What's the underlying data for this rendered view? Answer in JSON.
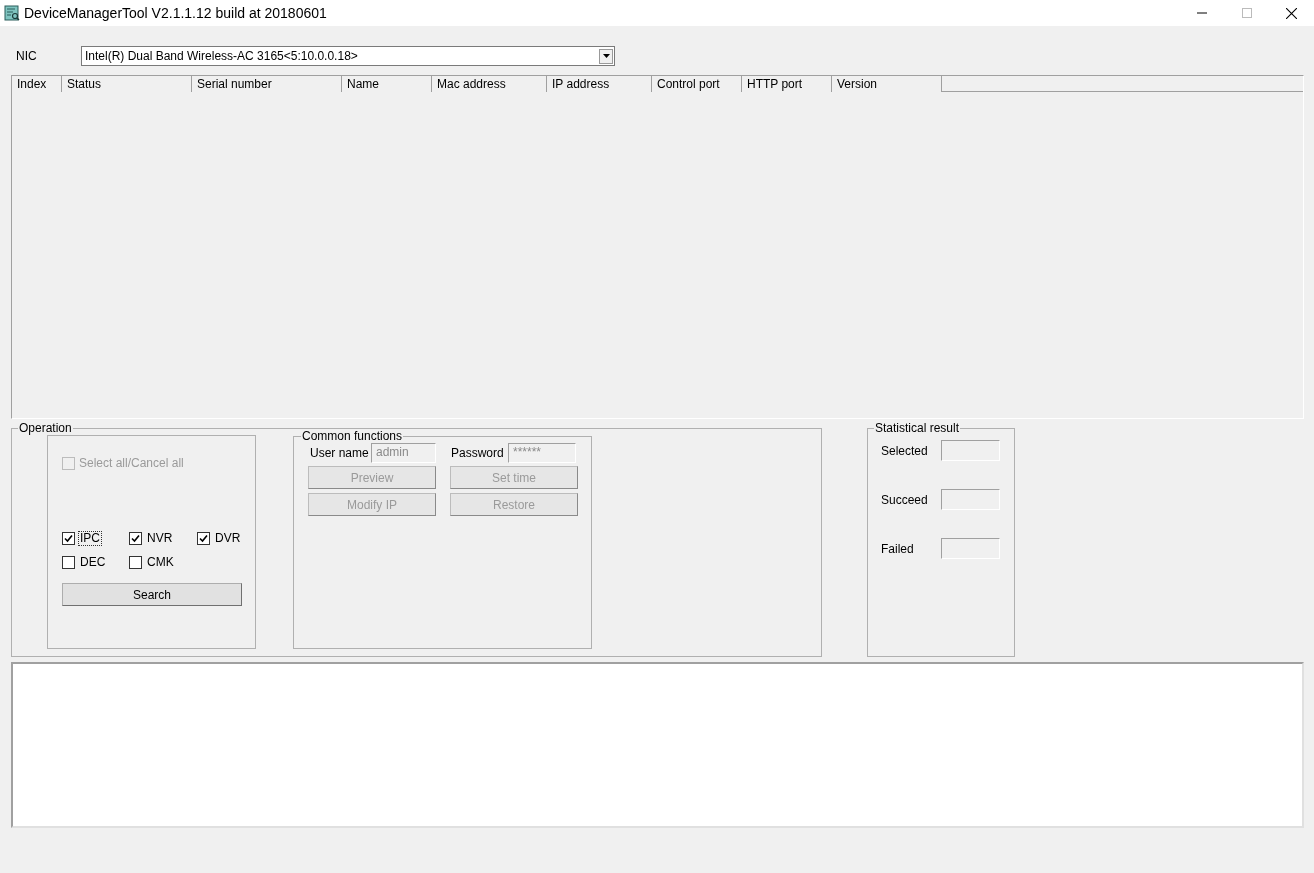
{
  "window": {
    "title": "DeviceManagerTool V2.1.1.12 build at 20180601"
  },
  "nic": {
    "label": "NIC",
    "value": "Intel(R) Dual Band Wireless-AC 3165<5:10.0.0.18>"
  },
  "table": {
    "columns": [
      "Index",
      "Status",
      "Serial number",
      "Name",
      "Mac address",
      "IP address",
      "Control port",
      "HTTP port",
      "Version"
    ]
  },
  "operation": {
    "title": "Operation",
    "select_all": {
      "label": "Select all/Cancel all",
      "checked": false,
      "disabled": true
    },
    "device_types": [
      {
        "label": "IPC",
        "checked": true,
        "focused": true
      },
      {
        "label": "NVR",
        "checked": true,
        "focused": false
      },
      {
        "label": "DVR",
        "checked": true,
        "focused": false
      },
      {
        "label": "DEC",
        "checked": false,
        "focused": false
      },
      {
        "label": "CMK",
        "checked": false,
        "focused": false
      }
    ],
    "search_button": "Search"
  },
  "common_functions": {
    "title": "Common functions",
    "fields": [
      {
        "label": "User name",
        "value": "admin"
      },
      {
        "label": "Password",
        "value": "******"
      }
    ],
    "buttons": [
      {
        "label": "Preview",
        "disabled": true
      },
      {
        "label": "Set time",
        "disabled": true
      },
      {
        "label": "Modify IP",
        "disabled": true
      },
      {
        "label": "Restore",
        "disabled": true
      }
    ]
  },
  "statistics": {
    "title": "Statistical result",
    "fields": [
      {
        "label": "Selected"
      },
      {
        "label": "Succeed"
      },
      {
        "label": "Failed"
      }
    ]
  }
}
